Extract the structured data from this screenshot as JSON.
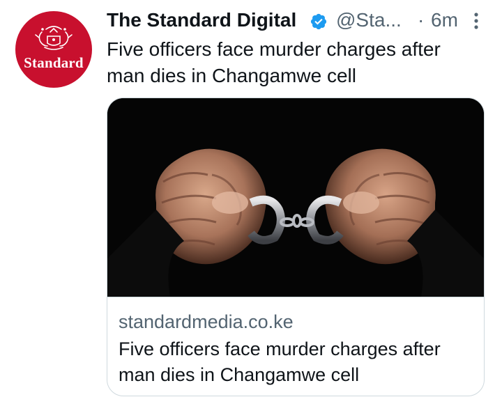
{
  "tweet": {
    "author": {
      "display_name": "The Standard Digital",
      "handle": "@Sta...",
      "verified": true,
      "avatar_text": "Standard"
    },
    "separator": "·",
    "time": "6m",
    "text": "Five officers face murder charges after man dies in Changamwe cell",
    "card": {
      "image_icon": "handcuffed-hands-photo",
      "domain": "standardmedia.co.ke",
      "title": "Five officers face murder charges after man dies in Changamwe cell"
    }
  },
  "colors": {
    "brand_red": "#c8102e",
    "verified_blue": "#1d9bf0",
    "secondary_text": "#536471",
    "border": "#cfd9de"
  }
}
